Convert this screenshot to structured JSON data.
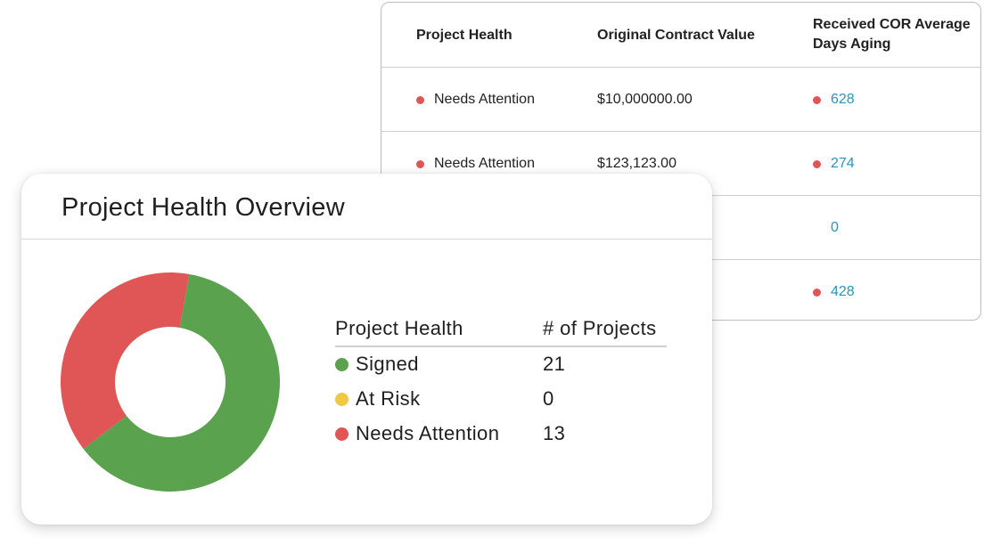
{
  "table": {
    "columns": [
      "Project Health",
      "Original Contract Value",
      "Received COR Average Days Aging"
    ],
    "rows": [
      {
        "health": "Needs Attention",
        "health_color": "#e05555",
        "contract": "$10,000000.00",
        "aging": "628",
        "aging_dot": "#e05555"
      },
      {
        "health": "Needs Attention",
        "health_color": "#e05555",
        "contract": "$123,123.00",
        "aging": "274",
        "aging_dot": "#e05555"
      },
      {
        "health": "",
        "health_color": "",
        "contract": "",
        "aging": "0",
        "aging_dot": ""
      },
      {
        "health": "",
        "health_color": "",
        "contract": "",
        "aging": "428",
        "aging_dot": "#e05555"
      }
    ]
  },
  "overview": {
    "title": "Project Health Overview",
    "legend_headers": [
      "Project Health",
      "# of Projects"
    ],
    "items": [
      {
        "label": "Signed",
        "count": "21",
        "color": "#5aa24e"
      },
      {
        "label": "At Risk",
        "count": "0",
        "color": "#efc844"
      },
      {
        "label": "Needs Attention",
        "count": "13",
        "color": "#e05656"
      }
    ]
  },
  "chart_data": {
    "type": "pie",
    "categories": [
      "Signed",
      "At Risk",
      "Needs Attention"
    ],
    "values": [
      21,
      0,
      13
    ],
    "colors": [
      "#5aa24e",
      "#efc844",
      "#e05656"
    ]
  }
}
